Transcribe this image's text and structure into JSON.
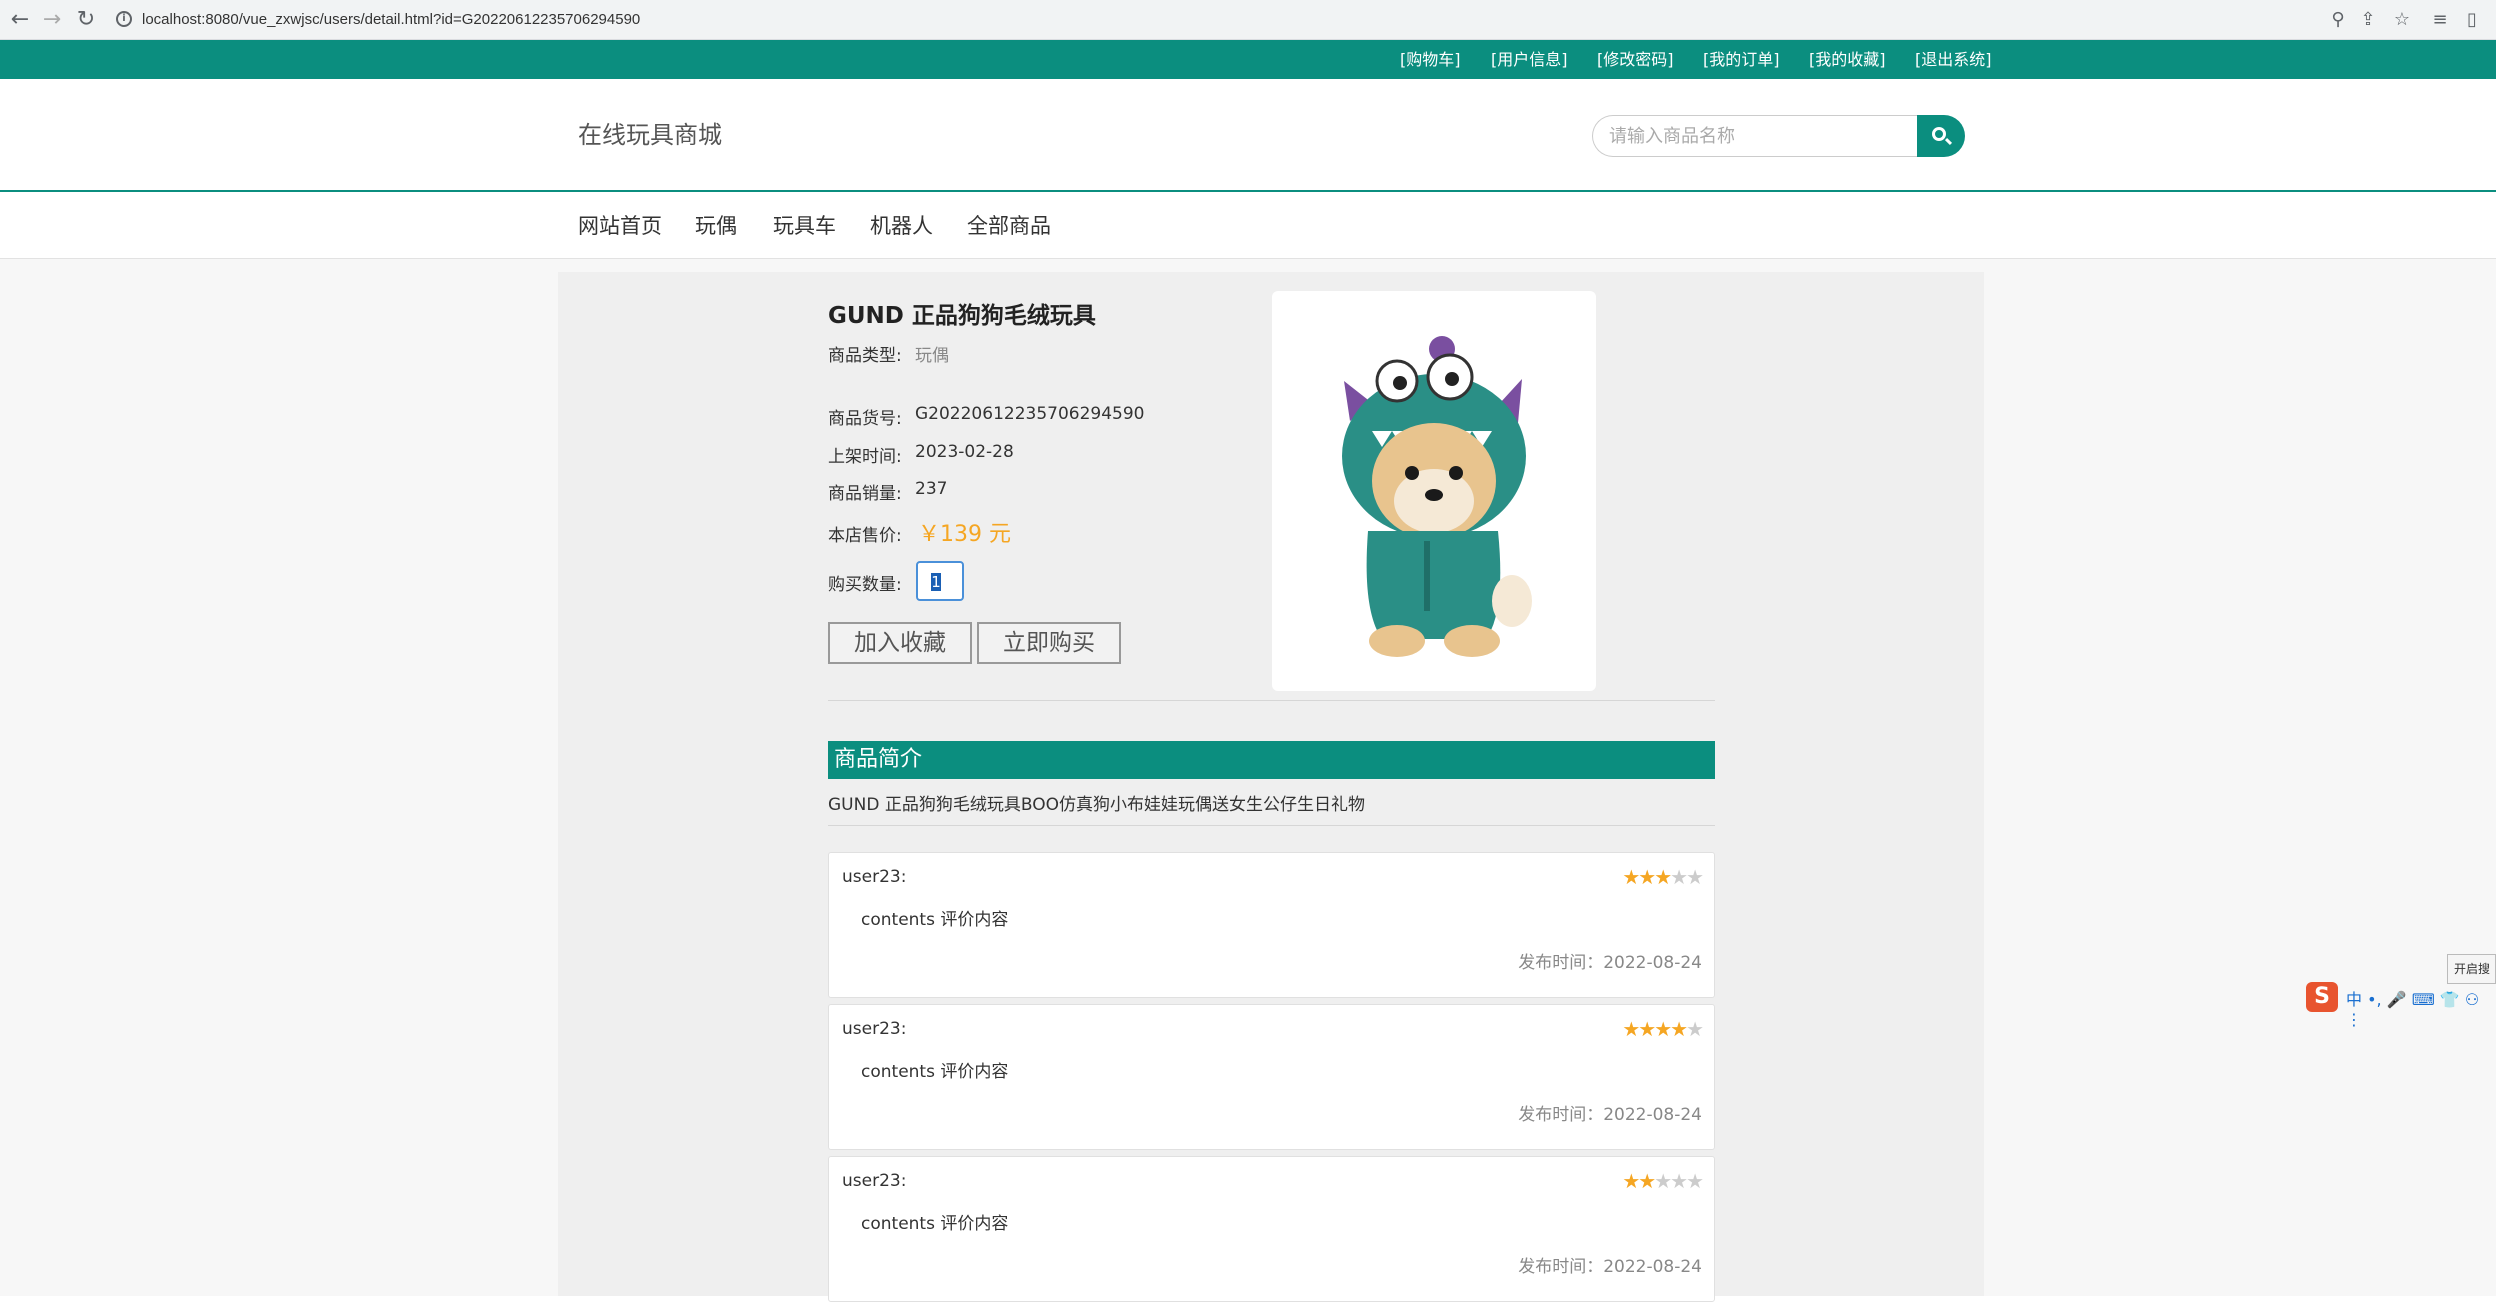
{
  "browser": {
    "url": "localhost:8080/vue_zxwjsc/users/detail.html?id=G20220612235706294590"
  },
  "top_links": [
    "[购物车]",
    "[用户信息]",
    "[修改密码]",
    "[我的订单]",
    "[我的收藏]",
    "[退出系统]"
  ],
  "header": {
    "site_title": "在线玩具商城",
    "search_placeholder": "请输入商品名称"
  },
  "nav": [
    "网站首页",
    "玩偶",
    "玩具车",
    "机器人",
    "全部商品"
  ],
  "product": {
    "title": "GUND 正品狗狗毛绒玩具",
    "type_label": "商品类型:",
    "type_value": "玩偶",
    "sku_label": "商品货号:",
    "sku_value": "G20220612235706294590",
    "date_label": "上架时间:",
    "date_value": "2023-02-28",
    "sales_label": "商品销量:",
    "sales_value": "237",
    "price_label": "本店售价:",
    "price_value": "￥139 元",
    "qty_label": "购买数量:",
    "qty_value": "1",
    "fav_button": "加入收藏",
    "buy_button": "立即购买"
  },
  "intro": {
    "heading": "商品简介",
    "text": "GUND 正品狗狗毛绒玩具BOO仿真狗小布娃娃玩偶送女生公仔生日礼物"
  },
  "reviews": [
    {
      "user": "user23:",
      "content": "contents 评价内容",
      "date": "发布时间：2022-08-24",
      "rating": 3
    },
    {
      "user": "user23:",
      "content": "contents 评价内容",
      "date": "发布时间：2022-08-24",
      "rating": 4
    },
    {
      "user": "user23:",
      "content": "contents 评价内容",
      "date": "发布时间：2022-08-24",
      "rating": 2
    }
  ],
  "ime": {
    "logo": "S",
    "text": "中 •, 🎤 ⌨ 👕 ⚇ ⋮",
    "tip": "开启搜"
  },
  "colors": {
    "accent": "#0b8e7f",
    "price": "#f5a623"
  }
}
